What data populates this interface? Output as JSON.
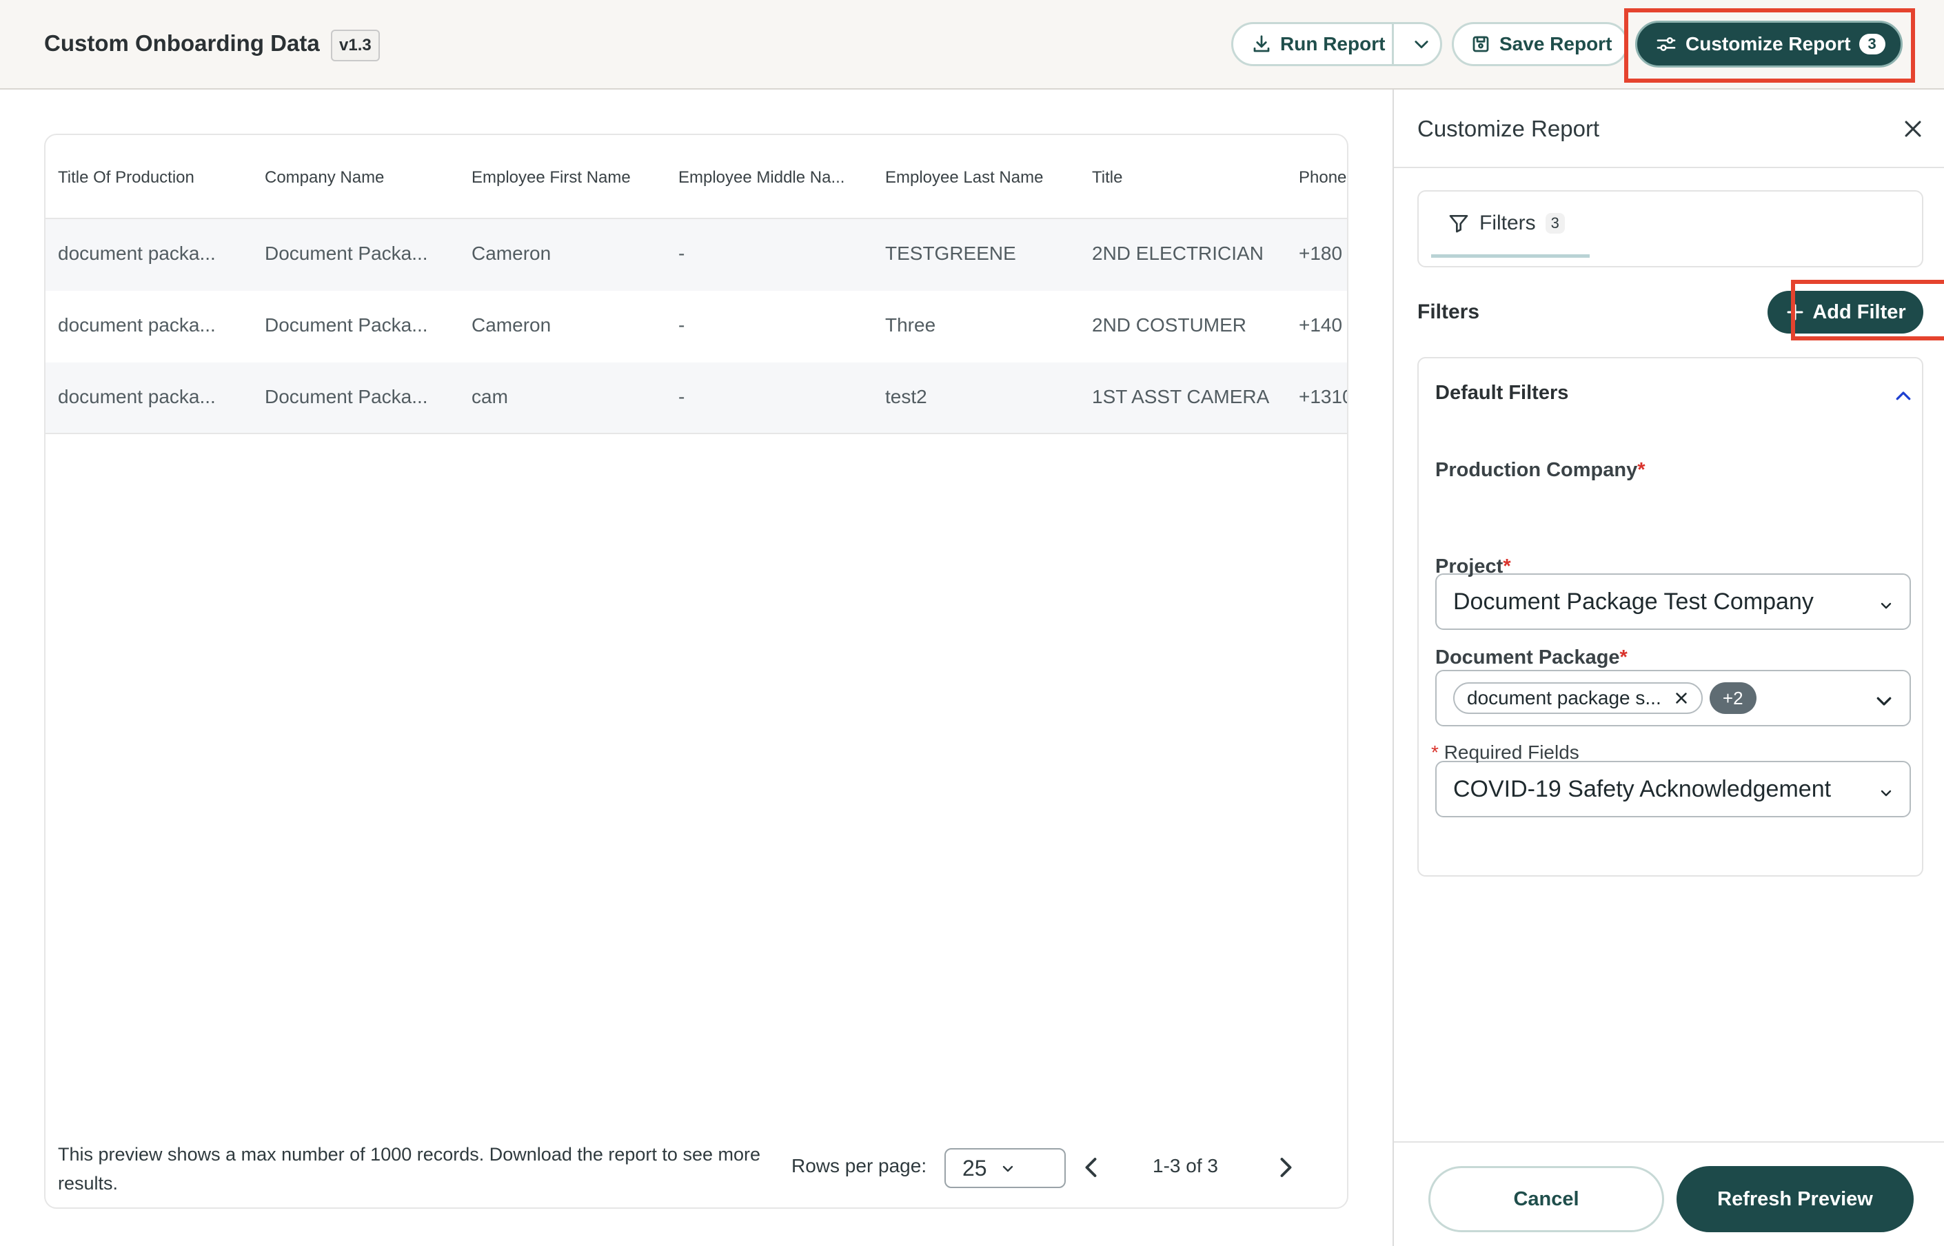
{
  "header": {
    "title": "Custom Onboarding Data",
    "version": "v1.3",
    "run_report_label": "Run Report",
    "save_report_label": "Save Report",
    "customize_report_label": "Customize Report",
    "customize_count": "3"
  },
  "table": {
    "columns": [
      "Title Of Production",
      "Company Name",
      "Employee First Name",
      "Employee Middle Na...",
      "Employee Last Name",
      "Title",
      "Phone"
    ],
    "rows": [
      [
        "document packa...",
        "Document Packa...",
        "Cameron",
        "-",
        "TESTGREENE",
        "2ND ELECTRICIAN",
        "+180"
      ],
      [
        "document packa...",
        "Document Packa...",
        "Cameron",
        "-",
        "Three",
        "2ND COSTUMER",
        "+140"
      ],
      [
        "document packa...",
        "Document Packa...",
        "cam",
        "-",
        "test2",
        "1ST ASST CAMERA",
        "+1310"
      ]
    ],
    "footer_note": "This preview shows a max number of 1000 records. Download the report to see more results.",
    "rows_per_page_label": "Rows per page:",
    "rows_per_page_value": "25",
    "page_range": "1-3 of 3"
  },
  "panel": {
    "title": "Customize Report",
    "tab_filters_label": "Filters",
    "tab_filters_count": "3",
    "filters_heading": "Filters",
    "add_filter_label": "Add Filter",
    "default_filters_title": "Default Filters",
    "production_company_label": "Production Company",
    "production_company_value": "Document Package Test Company",
    "project_label": "Project",
    "project_chip": "document package s...",
    "project_more": "+2",
    "document_package_label": "Document Package",
    "document_package_value": "COVID-19 Safety Acknowledgement",
    "required_marker": "*",
    "required_note": "Required Fields",
    "cancel_label": "Cancel",
    "refresh_label": "Refresh Preview"
  },
  "colors": {
    "primary": "#1d4a4a",
    "highlight": "#e5432e",
    "required": "#d9322b"
  }
}
